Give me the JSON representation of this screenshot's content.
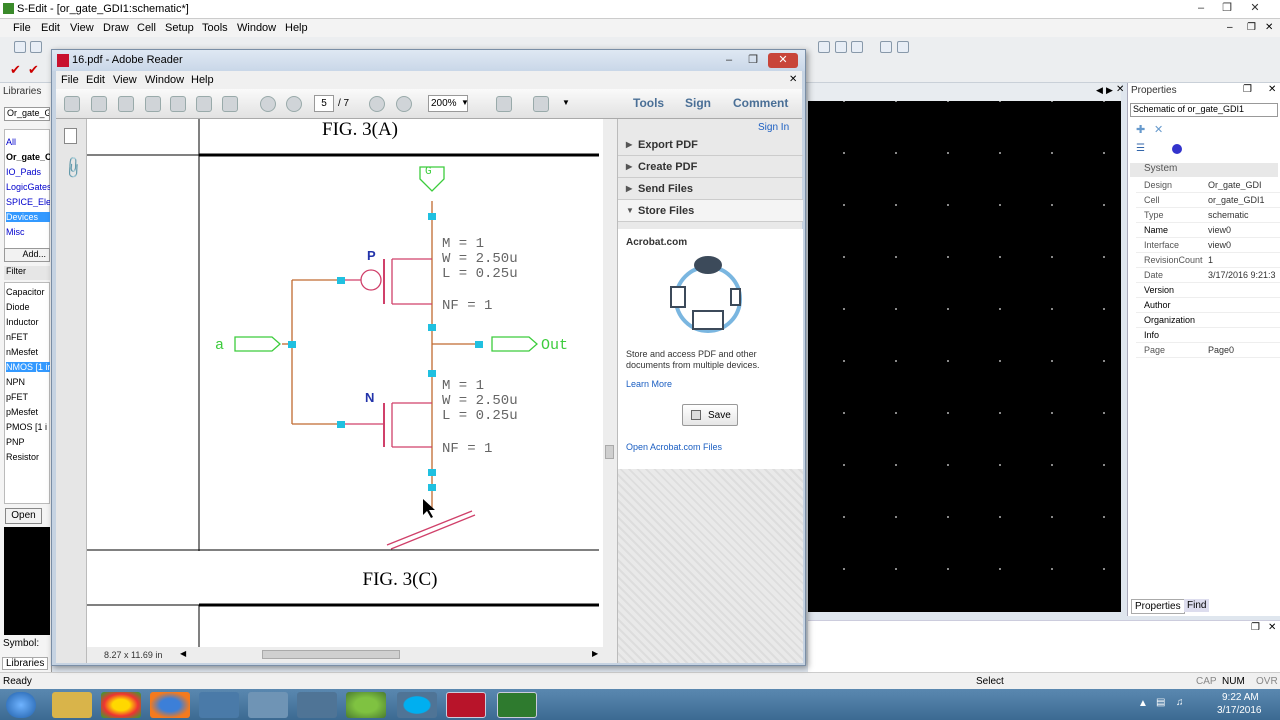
{
  "sedit": {
    "title": "S-Edit - [or_gate_GDI1:schematic*]",
    "menu": [
      "File",
      "Edit",
      "View",
      "Draw",
      "Cell",
      "Setup",
      "Tools",
      "Window",
      "Help"
    ],
    "libraries": {
      "header": "Libraries",
      "dropdown": "Or_gate_G",
      "items": [
        "All",
        "Or_gate_C",
        "IO_Pads",
        "LogicGates",
        "SPICE_Eler",
        "Devices",
        "Misc"
      ],
      "add_button": "Add...",
      "filter_label": "Filter",
      "cells": [
        "Capacitor",
        "Diode",
        "Inductor",
        "nFET",
        "nMesfet",
        "NMOS [1 in",
        "NPN",
        "pFET",
        "pMesfet",
        "PMOS [1 i",
        "PNP",
        "Resistor"
      ],
      "open_button": "Open",
      "symbol_label": "Symbol:",
      "bottom_tab": "Libraries"
    },
    "properties": {
      "header": "Properties",
      "subtitle": "Schematic of or_gate_GDI1",
      "section": "System",
      "rows": [
        {
          "k": "Design",
          "v": "Or_gate_GDI"
        },
        {
          "k": "Cell",
          "v": "or_gate_GDI1"
        },
        {
          "k": "Type",
          "v": "schematic"
        },
        {
          "k": "Name",
          "v": "view0"
        },
        {
          "k": "Interface",
          "v": "view0"
        },
        {
          "k": "RevisionCount",
          "v": "1"
        },
        {
          "k": "Date",
          "v": "3/17/2016 9:21:3"
        },
        {
          "k": "Version",
          "v": ""
        },
        {
          "k": "Author",
          "v": ""
        },
        {
          "k": "Organization",
          "v": ""
        },
        {
          "k": "Info",
          "v": ""
        },
        {
          "k": "Page",
          "v": "Page0"
        }
      ],
      "tabs": [
        "Properties",
        "Find"
      ]
    },
    "status": {
      "left": "Ready",
      "mode": "Select",
      "keys": [
        "CAP",
        "NUM",
        "OVR"
      ]
    }
  },
  "reader": {
    "title": "16.pdf - Adobe Reader",
    "menu": [
      "File",
      "Edit",
      "View",
      "Window",
      "Help"
    ],
    "page_current": "5",
    "page_total": "/ 7",
    "zoom": "200%",
    "right_buttons": [
      "Tools",
      "Sign",
      "Comment"
    ],
    "sign_in": "Sign In",
    "pane_items": [
      "Export PDF",
      "Create PDF",
      "Send Files",
      "Store Files"
    ],
    "acrobat_com": "Acrobat.com",
    "store_text": "Store and access PDF and other documents from multiple devices.",
    "learn_more": "Learn More",
    "save": "Save",
    "open_files": "Open Acrobat.com Files",
    "page_size": "8.27 x 11.69 in",
    "fig_a": "FIG. 3(A)",
    "fig_c": "FIG. 3(C)",
    "schematic": {
      "p_label": "P",
      "n_label": "N",
      "input": "a",
      "output": "Out",
      "p_params": [
        "M = 1",
        "W = 2.50u",
        "L = 0.25u"
      ],
      "n_params": [
        "M = 1",
        "W = 2.50u",
        "L = 0.25u"
      ],
      "nf": "NF = 1"
    }
  },
  "taskbar": {
    "time": "9:22 AM",
    "date": "3/17/2016"
  }
}
